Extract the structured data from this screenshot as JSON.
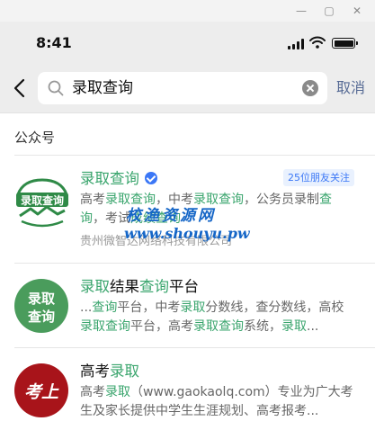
{
  "window": {
    "minimize": "—",
    "maximize": "▢",
    "close": "✕"
  },
  "status_bar": {
    "time": "8:41"
  },
  "search": {
    "query": "录取查询",
    "cancel_label": "取消"
  },
  "section": {
    "title": "公众号"
  },
  "results": [
    {
      "title_segments": [
        {
          "text": "录取查询",
          "highlight": true
        }
      ],
      "verified": true,
      "friends_badge": "25位朋友关注",
      "desc_segments": [
        {
          "text": "高考",
          "highlight": false
        },
        {
          "text": "录取查询",
          "highlight": true
        },
        {
          "text": "，中考",
          "highlight": false
        },
        {
          "text": "录取查询",
          "highlight": true
        },
        {
          "text": "，公务员录制",
          "highlight": false
        },
        {
          "text": "查询",
          "highlight": true
        },
        {
          "text": "，考试",
          "highlight": false
        },
        {
          "text": "成绩查询",
          "highlight": true
        }
      ],
      "company": "贵州微智达网络科技有限公司",
      "logo": {
        "name": "mountain-logo-icon",
        "text": "录取查询"
      }
    },
    {
      "title_segments": [
        {
          "text": "录取",
          "highlight": true
        },
        {
          "text": "结果",
          "highlight": false
        },
        {
          "text": "查询",
          "highlight": true
        },
        {
          "text": "平台",
          "highlight": false
        }
      ],
      "verified": false,
      "desc_segments": [
        {
          "text": "...",
          "highlight": false
        },
        {
          "text": "查询",
          "highlight": true
        },
        {
          "text": "平台，中考",
          "highlight": false
        },
        {
          "text": "录取",
          "highlight": true
        },
        {
          "text": "分数线，查分数线，高校",
          "highlight": false
        },
        {
          "text": "录取查询",
          "highlight": true
        },
        {
          "text": "平台，高考",
          "highlight": false
        },
        {
          "text": "录取查询",
          "highlight": true
        },
        {
          "text": "系统，",
          "highlight": false
        },
        {
          "text": "录取",
          "highlight": true
        },
        {
          "text": "...",
          "highlight": false
        }
      ],
      "logo": {
        "name": "circle-text-logo-icon",
        "line1": "录取",
        "line2": "查询"
      }
    },
    {
      "title_segments": [
        {
          "text": "高考",
          "highlight": false
        },
        {
          "text": "录取",
          "highlight": true
        }
      ],
      "verified": false,
      "desc_segments": [
        {
          "text": "高考",
          "highlight": false
        },
        {
          "text": "录取",
          "highlight": true
        },
        {
          "text": "（www.gaokaolq.com）专业为广大考生及家长提供中学生生涯规划、高考报考...",
          "highlight": false
        }
      ],
      "logo": {
        "name": "kaoshang-logo-icon",
        "text": "考上"
      }
    }
  ],
  "watermark": {
    "line1": "校渔资源网",
    "line2": "www.shouyu.pw"
  },
  "colors": {
    "highlight": "#3aa56d",
    "link": "#576b95",
    "badge_text": "#3b77f6",
    "watermark": "#1566c7"
  }
}
